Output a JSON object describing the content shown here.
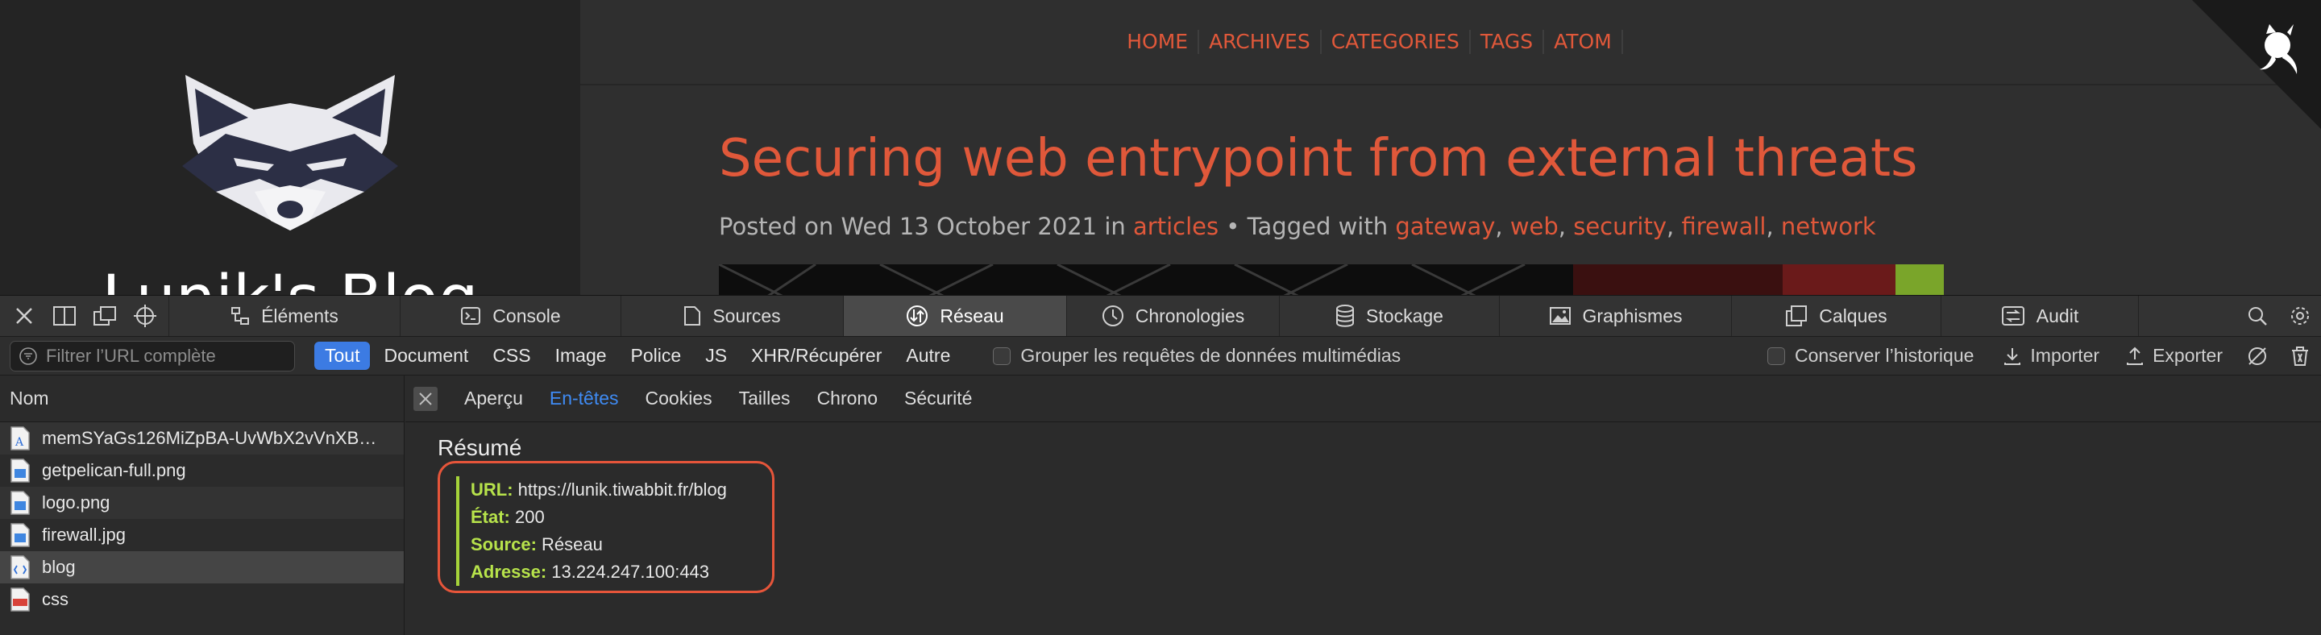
{
  "blog": {
    "site_name": "Lunik's Blog",
    "nav": [
      "HOME",
      "ARCHIVES",
      "CATEGORIES",
      "TAGS",
      "ATOM"
    ],
    "post": {
      "title": "Securing web entrypoint from external threats",
      "posted_prefix": "Posted on Wed 13 October 2021 in ",
      "category": "articles",
      "tagged_prefix": " • Tagged with ",
      "tags": [
        "gateway",
        "web",
        "security",
        "firewall",
        "network"
      ]
    },
    "colors": {
      "accent": "#e0583a",
      "sidebar": "#242424",
      "page": "#2f2f2f"
    }
  },
  "inspector": {
    "tabs": [
      {
        "label": "Éléments",
        "icon": "elements-icon"
      },
      {
        "label": "Console",
        "icon": "console-icon"
      },
      {
        "label": "Sources",
        "icon": "sources-icon"
      },
      {
        "label": "Réseau",
        "icon": "network-icon",
        "active": true
      },
      {
        "label": "Chronologies",
        "icon": "timelines-icon"
      },
      {
        "label": "Stockage",
        "icon": "storage-icon"
      },
      {
        "label": "Graphismes",
        "icon": "graphics-icon"
      },
      {
        "label": "Calques",
        "icon": "layers-icon"
      },
      {
        "label": "Audit",
        "icon": "audit-icon"
      }
    ],
    "filter": {
      "placeholder": "Filtrer l’URL complète",
      "types": [
        "Tout",
        "Document",
        "CSS",
        "Image",
        "Police",
        "JS",
        "XHR/Récupérer",
        "Autre"
      ],
      "selected_type": "Tout",
      "group_media_label": "Grouper les requêtes de données multimédias",
      "preserve_log_label": "Conserver l’historique",
      "import_label": "Importer",
      "export_label": "Exporter"
    },
    "requests": {
      "column": "Nom",
      "items": [
        {
          "name": "memSYaGs126MiZpBA-UvWbX2vVnXB…",
          "type": "font"
        },
        {
          "name": "getpelican-full.png",
          "type": "image"
        },
        {
          "name": "logo.png",
          "type": "image"
        },
        {
          "name": "firewall.jpg",
          "type": "image"
        },
        {
          "name": "blog",
          "type": "document",
          "selected": true
        },
        {
          "name": "css",
          "type": "stylesheet"
        }
      ]
    },
    "detail": {
      "tabs": [
        "Aperçu",
        "En-têtes",
        "Cookies",
        "Tailles",
        "Chrono",
        "Sécurité"
      ],
      "active_tab": "En-têtes",
      "summary_title": "Résumé",
      "summary": [
        {
          "key": "URL:",
          "value": "https://lunik.tiwabbit.fr/blog"
        },
        {
          "key": "État:",
          "value": "200"
        },
        {
          "key": "Source:",
          "value": "Réseau"
        },
        {
          "key": "Adresse:",
          "value": "13.224.247.100:443"
        }
      ],
      "colors": {
        "highlight": "#e6553a",
        "key": "#b7e34b",
        "active_tab": "#3f8bf3"
      }
    }
  }
}
